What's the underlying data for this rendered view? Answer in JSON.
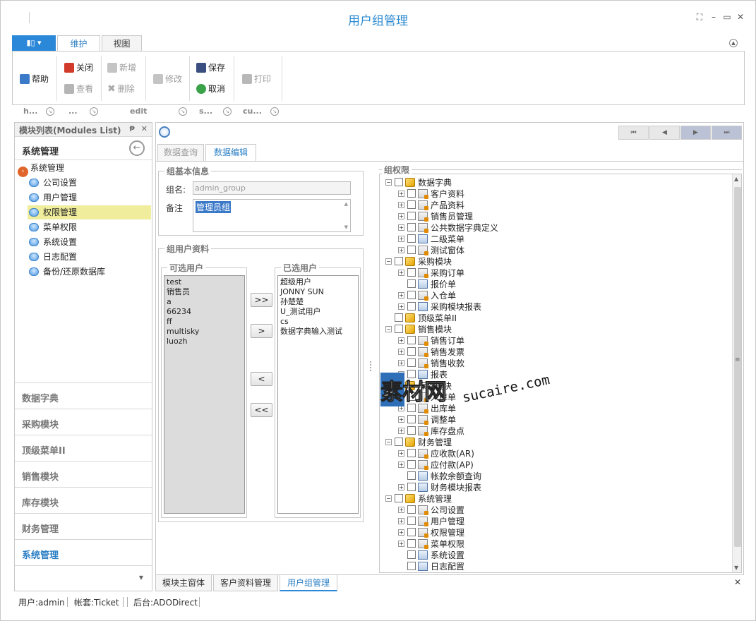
{
  "window": {
    "title": "用户组管理",
    "controls": [
      "restore",
      "minimize",
      "maximize",
      "close"
    ]
  },
  "ribbon": {
    "tabs": [
      {
        "label": "维护",
        "active": true
      },
      {
        "label": "视图",
        "active": false
      }
    ],
    "buttons": {
      "help": "帮助",
      "close": "关闭",
      "view": "查看",
      "add": "新增",
      "delete": "删除",
      "edit": "修改",
      "save": "保存",
      "cancel": "取消",
      "print": "打印"
    },
    "groups": [
      "h...",
      "...",
      "edit",
      "s...",
      "cu..."
    ]
  },
  "left_panel": {
    "header": "模块列表(Modules List)",
    "pin_glyph": "ᵽ",
    "close_glyph": "✕",
    "section_title": "系统管理",
    "tree_root": "系统管理",
    "tree_items": [
      "公司设置",
      "用户管理",
      "权限管理",
      "菜单权限",
      "系统设置",
      "日志配置",
      "备份/还原数据库"
    ],
    "selected_item": "权限管理",
    "nav": [
      "数据字典",
      "采购模块",
      "顶级菜单II",
      "销售模块",
      "库存模块",
      "财务管理",
      "系统管理"
    ],
    "nav_active": "系统管理"
  },
  "main": {
    "tabs": [
      {
        "label": "数据查询",
        "active": false
      },
      {
        "label": "数据编辑",
        "active": true
      }
    ],
    "basic": {
      "title": "组基本信息",
      "name_label": "组名:",
      "name_value": "admin_group",
      "remark_label": "备注",
      "remark_value": "管理员组"
    },
    "users": {
      "title": "组用户资料",
      "available_title": "可选用户",
      "available": [
        "test",
        "销售员",
        "a",
        "66234",
        "ff",
        "multisky",
        "luozh"
      ],
      "selected_title": "已选用户",
      "selected": [
        "超级用户",
        "JONNY SUN",
        "孙楚楚",
        "U_测试用户",
        "cs",
        "数据字典输入测试"
      ],
      "btn_add_all": ">>",
      "btn_add": ">",
      "btn_remove": "<",
      "btn_remove_all": "<<"
    },
    "perm": {
      "title": "组权限",
      "nodes": [
        {
          "label": "数据字典",
          "level": 0,
          "type": "module",
          "expander": "-"
        },
        {
          "label": "客户资料",
          "level": 1,
          "type": "form",
          "expander": "+"
        },
        {
          "label": "产品资料",
          "level": 1,
          "type": "form",
          "expander": "+"
        },
        {
          "label": "销售员管理",
          "level": 1,
          "type": "form",
          "expander": "+"
        },
        {
          "label": "公共数据字典定义",
          "level": 1,
          "type": "form",
          "expander": "+"
        },
        {
          "label": "二级菜单",
          "level": 1,
          "type": "table",
          "expander": "+"
        },
        {
          "label": "测试窗体",
          "level": 1,
          "type": "form",
          "expander": "+"
        },
        {
          "label": "采购模块",
          "level": 0,
          "type": "module",
          "expander": "-"
        },
        {
          "label": "采购订单",
          "level": 1,
          "type": "form",
          "expander": "+"
        },
        {
          "label": "报价单",
          "level": 1,
          "type": "table",
          "expander": ""
        },
        {
          "label": "入仓单",
          "level": 1,
          "type": "form",
          "expander": "+"
        },
        {
          "label": "采购模块报表",
          "level": 1,
          "type": "table",
          "expander": "+"
        },
        {
          "label": "顶级菜单II",
          "level": 0,
          "type": "module",
          "expander": ""
        },
        {
          "label": "销售模块",
          "level": 0,
          "type": "module",
          "expander": "-"
        },
        {
          "label": "销售订单",
          "level": 1,
          "type": "form",
          "expander": "+"
        },
        {
          "label": "销售发票",
          "level": 1,
          "type": "form",
          "expander": "+"
        },
        {
          "label": "销售收款",
          "level": 1,
          "type": "form",
          "expander": "+"
        },
        {
          "label": "报表",
          "level": 1,
          "type": "table",
          "expander": "+"
        },
        {
          "label": "库存模块",
          "level": 0,
          "type": "module",
          "expander": "-"
        },
        {
          "label": "入库单",
          "level": 1,
          "type": "form",
          "expander": "+"
        },
        {
          "label": "出库单",
          "level": 1,
          "type": "form",
          "expander": "+"
        },
        {
          "label": "调整单",
          "level": 1,
          "type": "form",
          "expander": "+"
        },
        {
          "label": "库存盘点",
          "level": 1,
          "type": "form",
          "expander": "+"
        },
        {
          "label": "财务管理",
          "level": 0,
          "type": "module",
          "expander": "-"
        },
        {
          "label": "应收款(AR)",
          "level": 1,
          "type": "form",
          "expander": "+"
        },
        {
          "label": "应付款(AP)",
          "level": 1,
          "type": "form",
          "expander": "+"
        },
        {
          "label": "帐款余额查询",
          "level": 1,
          "type": "table",
          "expander": ""
        },
        {
          "label": "财务模块报表",
          "level": 1,
          "type": "table",
          "expander": "+"
        },
        {
          "label": "系统管理",
          "level": 0,
          "type": "module",
          "expander": "-"
        },
        {
          "label": "公司设置",
          "level": 1,
          "type": "form",
          "expander": "+"
        },
        {
          "label": "用户管理",
          "level": 1,
          "type": "form",
          "expander": "+"
        },
        {
          "label": "权限管理",
          "level": 1,
          "type": "form",
          "expander": "+"
        },
        {
          "label": "菜单权限",
          "level": 1,
          "type": "form",
          "expander": "+"
        },
        {
          "label": "系统设置",
          "level": 1,
          "type": "table",
          "expander": ""
        },
        {
          "label": "日志配置",
          "level": 1,
          "type": "table",
          "expander": ""
        }
      ]
    },
    "record_nav": [
      "first",
      "prev",
      "next",
      "last"
    ]
  },
  "doc_tabs": [
    {
      "label": "模块主窗体",
      "active": false
    },
    {
      "label": "客户资料管理",
      "active": false
    },
    {
      "label": "用户组管理",
      "active": true
    }
  ],
  "status": {
    "user": "用户:admin",
    "account": "帐套:Ticket",
    "backend": "后台:ADODirect"
  },
  "watermark": {
    "cn": "素材网",
    "en": "sucaire.com"
  },
  "colors": {
    "accent": "#2b88d8",
    "selection": "#f0ed9c",
    "module_icon": "#e2a400"
  }
}
